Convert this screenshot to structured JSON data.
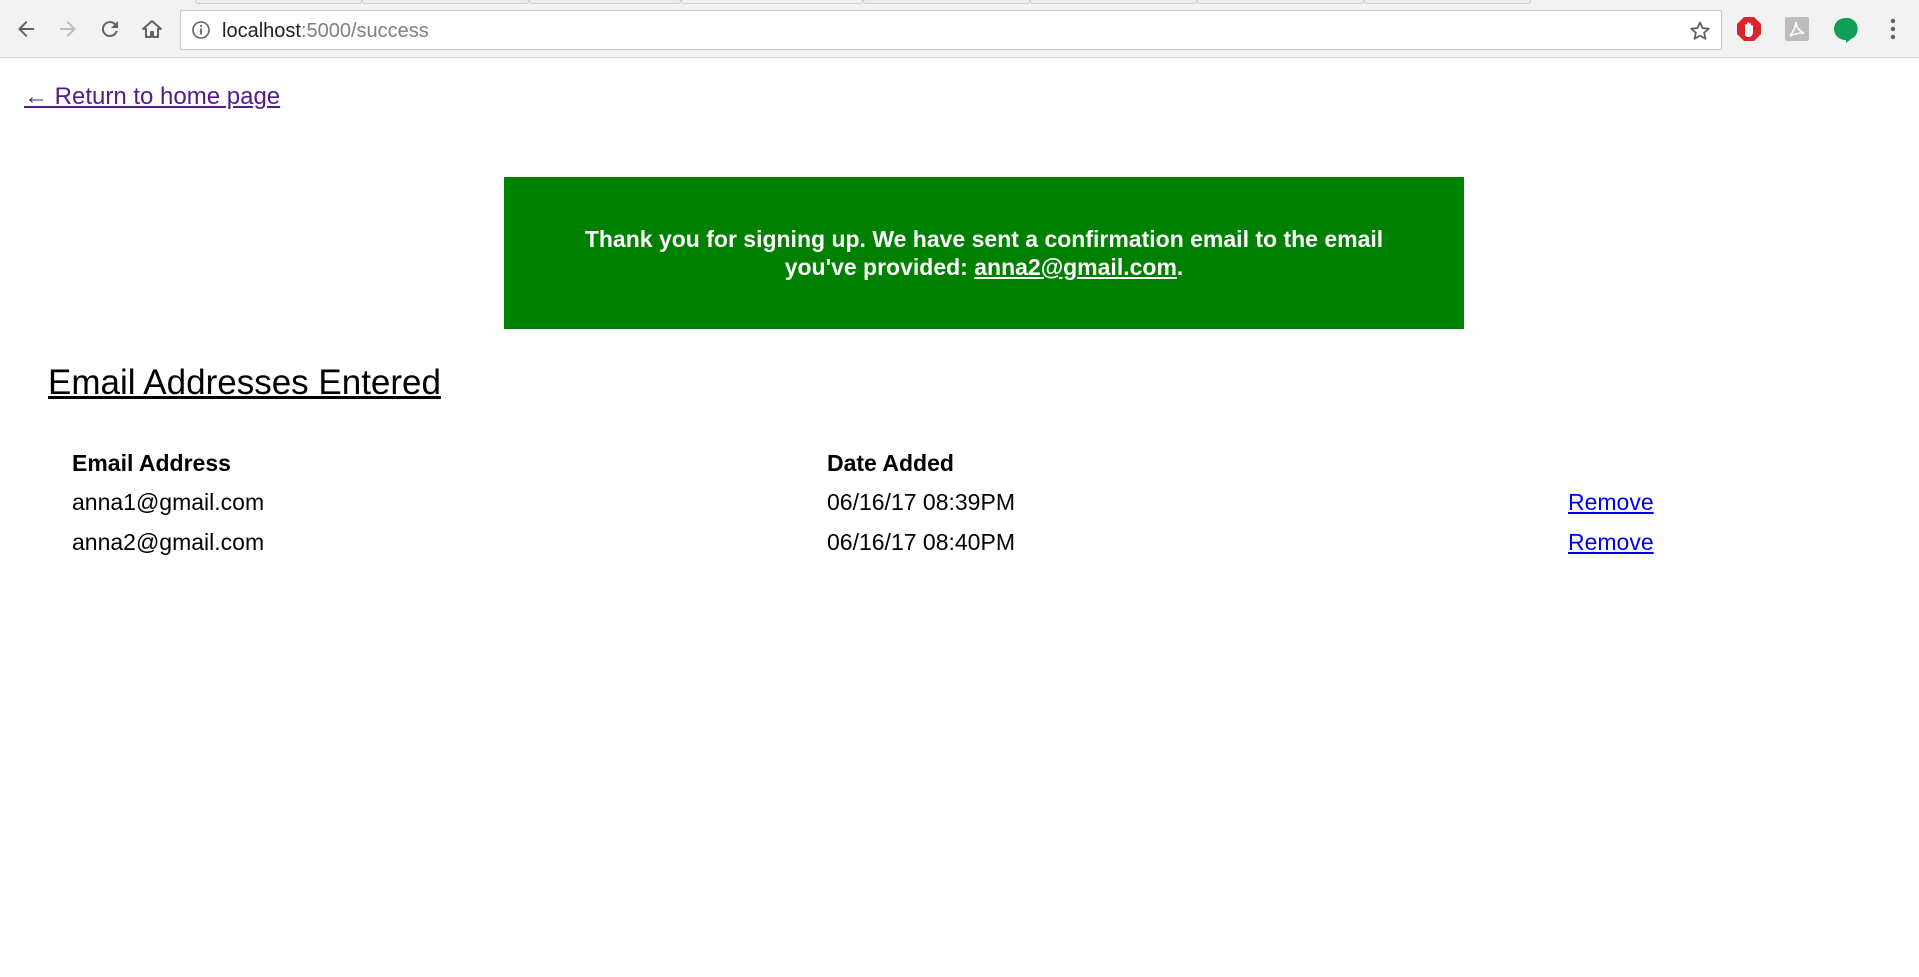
{
  "browser": {
    "url_host": "localhost",
    "url_path": ":5000/success"
  },
  "page": {
    "home_link": "← Return to home page",
    "banner": {
      "text_before": "Thank you for signing up. We have sent a confirmation email to the email you've provided:",
      "email": "anna2@gmail.com",
      "text_after": "."
    },
    "section_title": "Email Addresses Entered",
    "table": {
      "headers": [
        "Email Address",
        "Date Added"
      ],
      "rows": [
        {
          "email": "anna1@gmail.com",
          "date": "06/16/17 08:39PM",
          "action": "Remove"
        },
        {
          "email": "anna2@gmail.com",
          "date": "06/16/17 08:40PM",
          "action": "Remove"
        }
      ]
    }
  },
  "colors": {
    "banner_bg": "#008000",
    "visited_link": "#551a8b",
    "link": "#0000ee"
  }
}
